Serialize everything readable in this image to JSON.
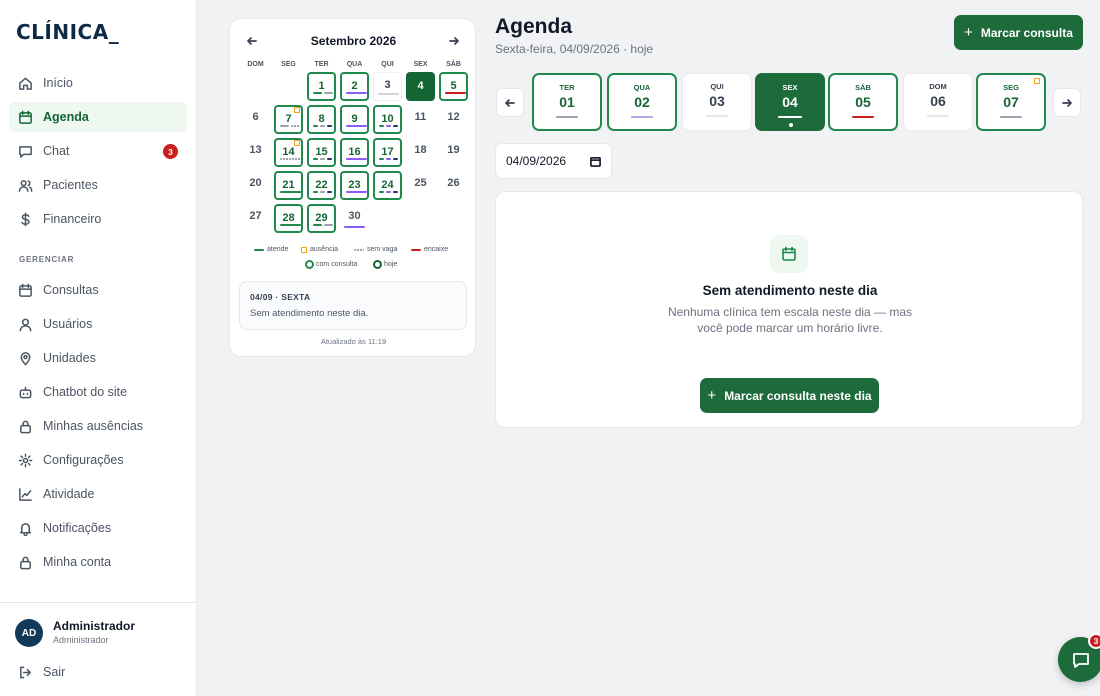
{
  "logo": "CLÍNICA_",
  "sidebar": {
    "items": [
      {
        "label": "Início",
        "icon": "home-icon"
      },
      {
        "label": "Agenda",
        "icon": "calendar-icon",
        "active": true
      },
      {
        "label": "Chat",
        "icon": "chat-icon",
        "badge": "3"
      },
      {
        "label": "Pacientes",
        "icon": "users-icon"
      },
      {
        "label": "Financeiro",
        "icon": "dollar-icon"
      }
    ],
    "section_label": "GERENCIAR",
    "manage_items": [
      {
        "label": "Consultas",
        "icon": "calendar-icon"
      },
      {
        "label": "Usuários",
        "icon": "user-icon"
      },
      {
        "label": "Unidades",
        "icon": "map-pin-icon"
      },
      {
        "label": "Chatbot do site",
        "icon": "bot-icon"
      },
      {
        "label": "Minhas ausências",
        "icon": "lock-icon"
      },
      {
        "label": "Configurações",
        "icon": "gear-icon"
      },
      {
        "label": "Atividade",
        "icon": "activity-chart-icon"
      },
      {
        "label": "Notificações",
        "icon": "bell-icon"
      },
      {
        "label": "Minha conta",
        "icon": "lock-icon"
      }
    ],
    "user": {
      "initials": "AD",
      "name": "Administrador",
      "role": "Administrador"
    },
    "logout": "Sair"
  },
  "calendar": {
    "title": "Setembro 2026",
    "weekdays": [
      "DOM",
      "SEG",
      "TER",
      "QUA",
      "QUI",
      "SEX",
      "SÁB"
    ],
    "days": [
      {
        "n": "1",
        "col": 2,
        "row": 0,
        "state": "avail",
        "marks": [
          "green",
          "gray"
        ]
      },
      {
        "n": "2",
        "col": 3,
        "row": 0,
        "state": "avail",
        "marks": [
          "purple"
        ]
      },
      {
        "n": "3",
        "col": 4,
        "row": 0,
        "state": "plainbox",
        "marks": [
          "light"
        ]
      },
      {
        "n": "4",
        "col": 5,
        "row": 0,
        "state": "today",
        "marks": []
      },
      {
        "n": "5",
        "col": 6,
        "row": 0,
        "state": "avail",
        "marks": [
          "red"
        ]
      },
      {
        "n": "6",
        "col": 0,
        "row": 1,
        "state": "plain",
        "marks": []
      },
      {
        "n": "7",
        "col": 1,
        "row": 1,
        "state": "avail",
        "marks": [
          "gray",
          "dots"
        ],
        "lock": true
      },
      {
        "n": "8",
        "col": 2,
        "row": 1,
        "state": "avail",
        "marks": [
          "green",
          "gray",
          "dark"
        ]
      },
      {
        "n": "9",
        "col": 3,
        "row": 1,
        "state": "avail",
        "marks": [
          "purple"
        ]
      },
      {
        "n": "10",
        "col": 4,
        "row": 1,
        "state": "avail",
        "marks": [
          "green",
          "purple",
          "dark"
        ]
      },
      {
        "n": "11",
        "col": 5,
        "row": 1,
        "state": "plain",
        "marks": []
      },
      {
        "n": "12",
        "col": 6,
        "row": 1,
        "state": "plain",
        "marks": []
      },
      {
        "n": "13",
        "col": 0,
        "row": 2,
        "state": "plain",
        "marks": []
      },
      {
        "n": "14",
        "col": 1,
        "row": 2,
        "state": "avail",
        "marks": [
          "dots"
        ],
        "lock": true
      },
      {
        "n": "15",
        "col": 2,
        "row": 2,
        "state": "avail",
        "marks": [
          "green",
          "gray",
          "dark"
        ]
      },
      {
        "n": "16",
        "col": 3,
        "row": 2,
        "state": "avail",
        "marks": [
          "purple"
        ]
      },
      {
        "n": "17",
        "col": 4,
        "row": 2,
        "state": "avail",
        "marks": [
          "green",
          "purple",
          "dark"
        ]
      },
      {
        "n": "18",
        "col": 5,
        "row": 2,
        "state": "plain",
        "marks": []
      },
      {
        "n": "19",
        "col": 6,
        "row": 2,
        "state": "plain",
        "marks": []
      },
      {
        "n": "20",
        "col": 0,
        "row": 3,
        "state": "plain",
        "marks": []
      },
      {
        "n": "21",
        "col": 1,
        "row": 3,
        "state": "avail",
        "marks": [
          "green"
        ]
      },
      {
        "n": "22",
        "col": 2,
        "row": 3,
        "state": "avail",
        "marks": [
          "green",
          "gray",
          "dark"
        ]
      },
      {
        "n": "23",
        "col": 3,
        "row": 3,
        "state": "avail",
        "marks": [
          "purple"
        ]
      },
      {
        "n": "24",
        "col": 4,
        "row": 3,
        "state": "avail",
        "marks": [
          "green",
          "purple",
          "dark"
        ]
      },
      {
        "n": "25",
        "col": 5,
        "row": 3,
        "state": "plain",
        "marks": []
      },
      {
        "n": "26",
        "col": 6,
        "row": 3,
        "state": "plain",
        "marks": []
      },
      {
        "n": "27",
        "col": 0,
        "row": 4,
        "state": "plain",
        "marks": []
      },
      {
        "n": "28",
        "col": 1,
        "row": 4,
        "state": "avail",
        "marks": [
          "green"
        ]
      },
      {
        "n": "29",
        "col": 2,
        "row": 4,
        "state": "avail",
        "marks": [
          "green",
          "gray"
        ]
      },
      {
        "n": "30",
        "col": 3,
        "row": 4,
        "state": "plain",
        "marks": [
          "purple"
        ]
      }
    ],
    "legend": {
      "atende": "atende",
      "ausencia": "ausência",
      "sem_vaga": "sem vaga",
      "encaixe": "encaixe",
      "com_consulta": "com consulta",
      "hoje": "hoje"
    },
    "selected_title": "04/09 · SEXTA",
    "selected_text": "Sem atendimento neste dia.",
    "updated": "Atualizado às 11:19"
  },
  "header": {
    "title": "Agenda",
    "subtitle": "Sexta-feira, 04/09/2026 · hoje",
    "new_button": "Marcar consulta"
  },
  "strip": [
    {
      "weekday": "TER",
      "day": "01",
      "state": "avail",
      "bar": "green"
    },
    {
      "weekday": "QUA",
      "day": "02",
      "state": "avail",
      "bar": "purple"
    },
    {
      "weekday": "QUI",
      "day": "03",
      "state": "plain",
      "bar": "light"
    },
    {
      "weekday": "SEX",
      "day": "04",
      "state": "sel",
      "bar": "white"
    },
    {
      "weekday": "SÁB",
      "day": "05",
      "state": "avail",
      "bar": "red"
    },
    {
      "weekday": "DOM",
      "day": "06",
      "state": "plain",
      "bar": "light"
    },
    {
      "weekday": "SEG",
      "day": "07",
      "state": "avail",
      "bar": "gray",
      "lock": true
    }
  ],
  "date_input": {
    "value": "04/09/2026"
  },
  "empty": {
    "title": "Sem atendimento neste dia",
    "text": "Nenhuma clínica tem escala neste dia — mas você pode marcar um horário livre.",
    "button": "Marcar consulta neste dia"
  },
  "chat_fab": {
    "badge": "3"
  },
  "colors": {
    "primary": "#1d6b3b",
    "accent_green": "#1f8a4c",
    "ausencia": "#f59e0b",
    "encaixe": "#c81e1e",
    "com_consulta": "#7c3aed",
    "sem_vaga": "#9ca3af"
  }
}
